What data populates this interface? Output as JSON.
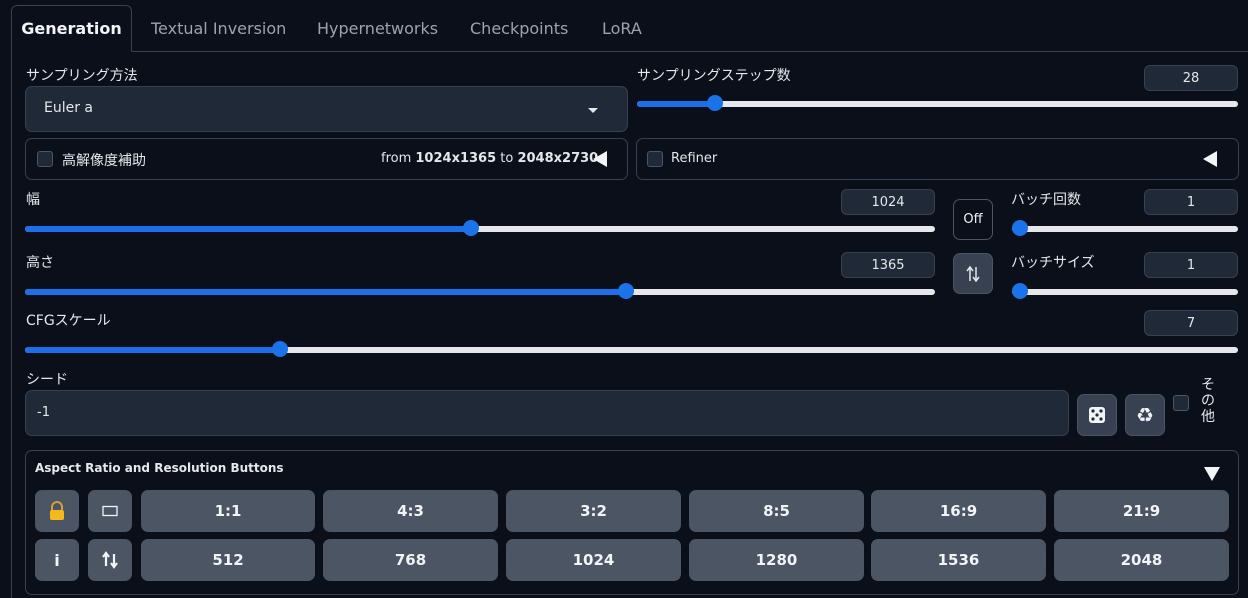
{
  "tabs": [
    "Generation",
    "Textual Inversion",
    "Hypernetworks",
    "Checkpoints",
    "LoRA"
  ],
  "sampling_method": {
    "label": "サンプリング方法",
    "value": "Euler a"
  },
  "sampling_steps": {
    "label": "サンプリングステップ数",
    "value": "28",
    "fraction": 0.13
  },
  "hires": {
    "label": "高解像度補助",
    "from_prefix": "from ",
    "from_res": "1024x1365",
    "to_prefix": " to ",
    "to_res": "2048x2730",
    "checked": false
  },
  "refiner": {
    "label": "Refiner",
    "checked": false
  },
  "width": {
    "label": "幅",
    "value": "1024",
    "fraction": 0.49
  },
  "height": {
    "label": "高さ",
    "value": "1365",
    "fraction": 0.66
  },
  "off_button": "Off",
  "batch_count": {
    "label": "バッチ回数",
    "value": "1",
    "fraction": 0.0
  },
  "batch_size": {
    "label": "バッチサイズ",
    "value": "1",
    "fraction": 0.0
  },
  "cfg_scale": {
    "label": "CFGスケール",
    "value": "7",
    "fraction": 0.21
  },
  "seed": {
    "label": "シード",
    "value": "-1"
  },
  "extra": {
    "label_1": "そ",
    "label_2": "の",
    "label_3": "他"
  },
  "aspect": {
    "title": "Aspect Ratio and Resolution Buttons",
    "ratios": [
      "1:1",
      "4:3",
      "3:2",
      "8:5",
      "16:9",
      "21:9"
    ],
    "resolutions": [
      "512",
      "768",
      "1024",
      "1280",
      "1536",
      "2048"
    ],
    "info_label": "i"
  },
  "colors": {
    "accent": "#1a73e8",
    "background": "#0b0f19",
    "button": "#4b5563"
  }
}
